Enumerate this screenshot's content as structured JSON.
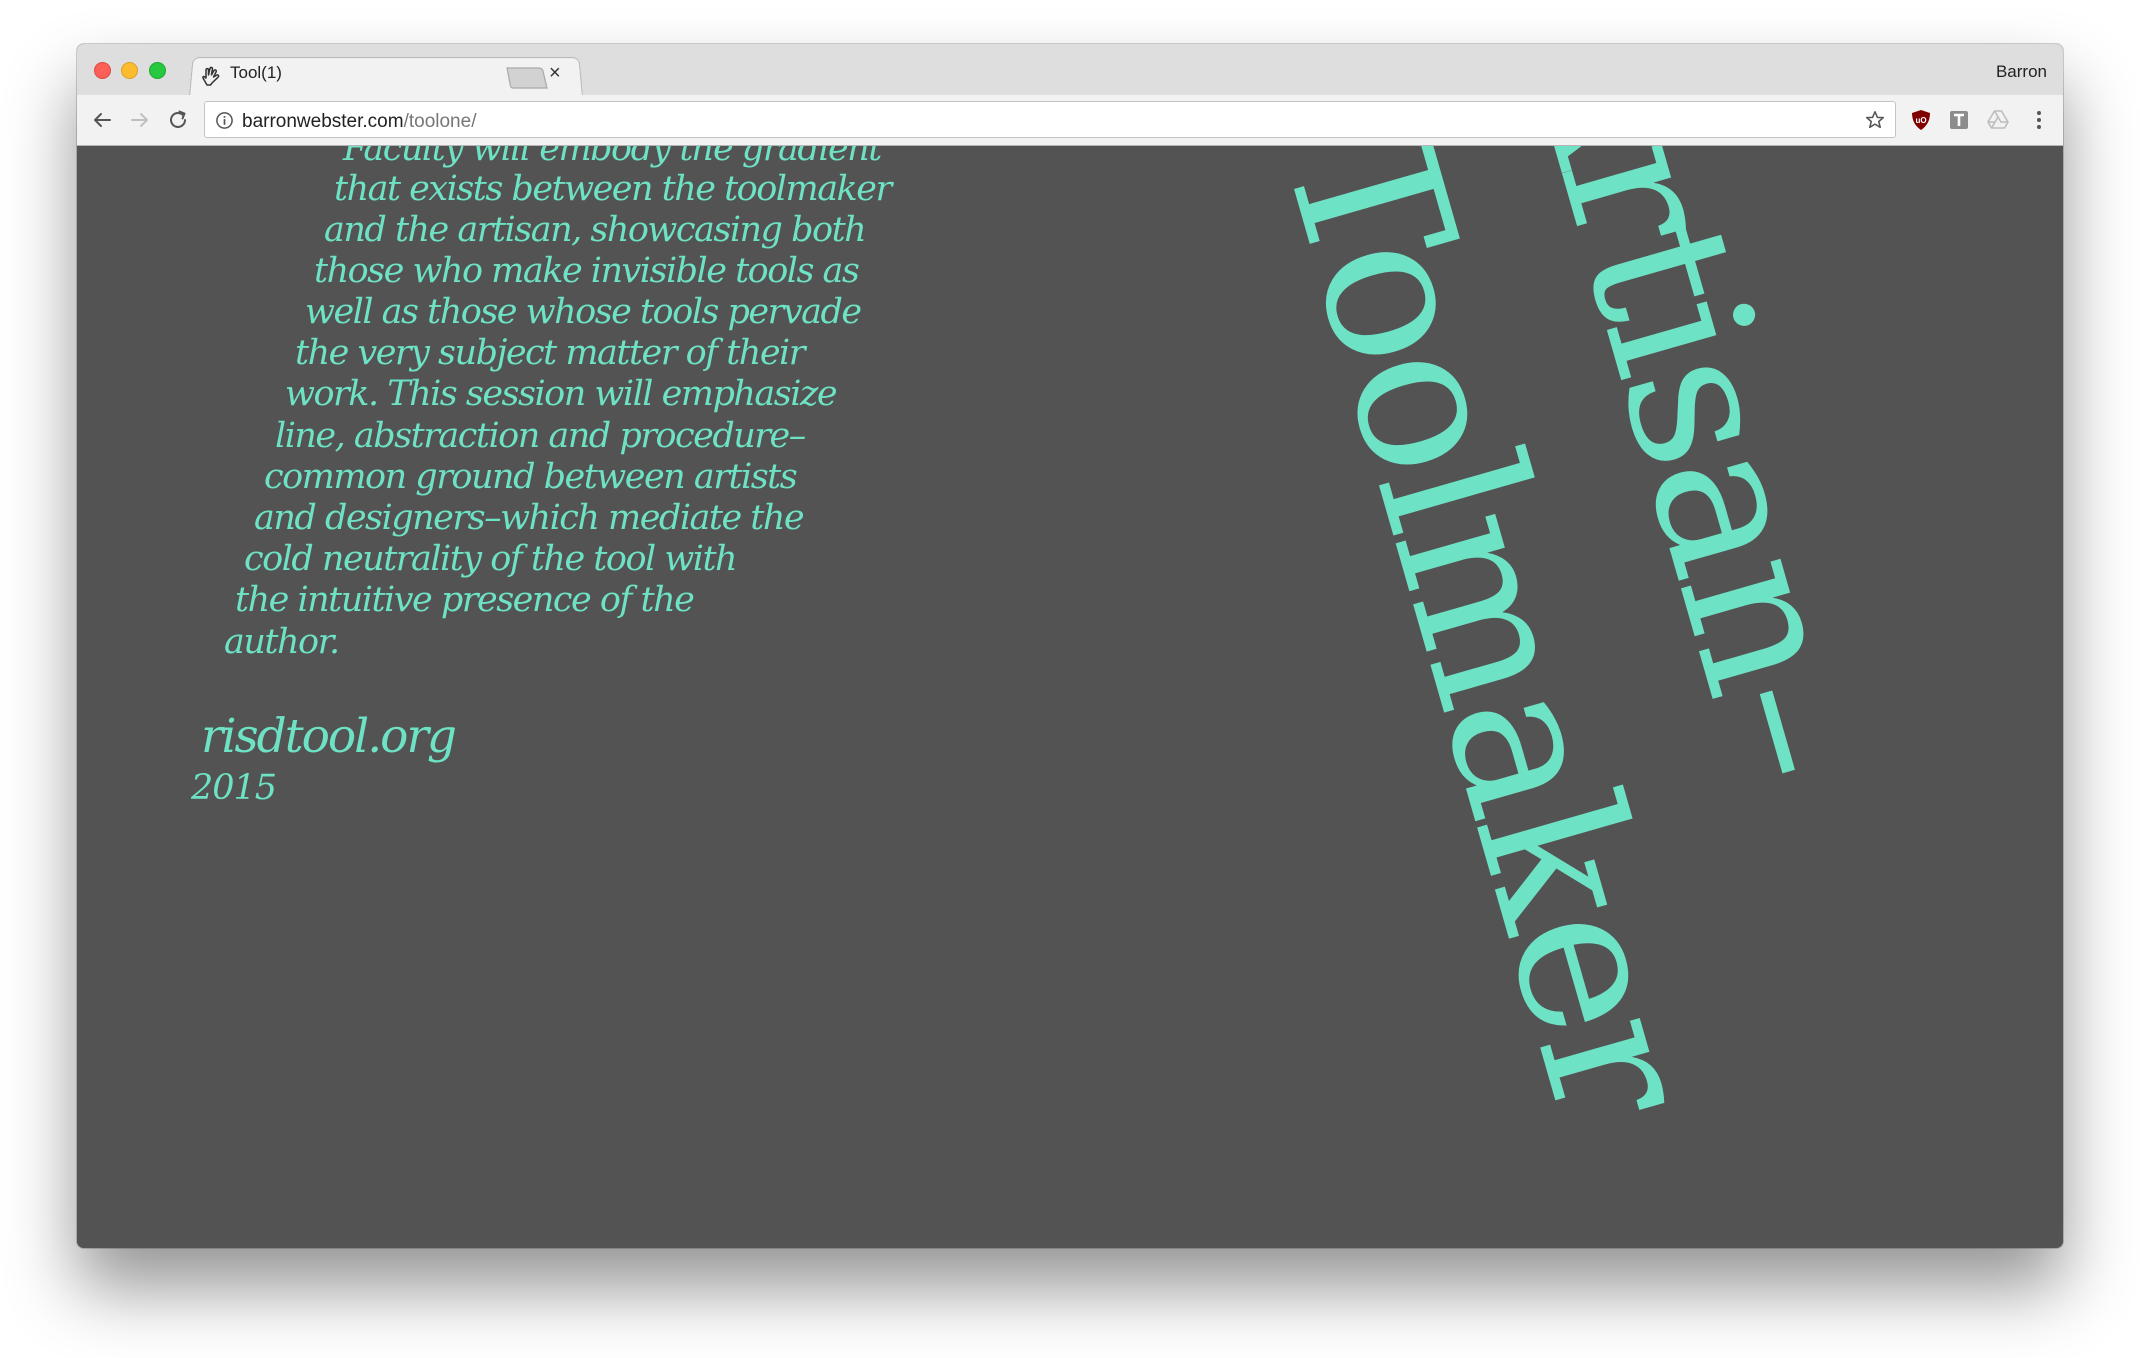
{
  "browser": {
    "tab_title": "Tool(1)",
    "tab_close": "×",
    "profile_name": "Barron",
    "url_host": "barronwebster.com",
    "url_path": "/toolone/"
  },
  "page": {
    "paragraph_lines": [
      "Faculty will embody the gradient",
      "that exists between the toolmaker",
      "and the artisan, showcasing both",
      "those who make invisible tools as",
      "well as those whose tools pervade",
      "the very subject matter of their",
      "work. This session will emphasize",
      "line, abstraction and procedure–",
      "common ground between artists",
      "and designers–which mediate the",
      "cold neutrality of the tool with",
      "the intuitive presence of the",
      "author."
    ],
    "site_link": "risdtool.org",
    "year": "2015",
    "big_words": [
      "Artisan–",
      "Toolmaker"
    ]
  },
  "colors": {
    "accent": "#6ee2c4",
    "page_background": "#535353",
    "tabstrip": "#dedede",
    "toolbar": "#f2f2f2"
  },
  "icons": {
    "favicon": "hand-pointer-icon",
    "back": "back-arrow-icon",
    "forward": "forward-arrow-icon",
    "reload": "reload-icon",
    "info": "info-icon",
    "bookmark": "star-icon",
    "extensions": [
      "ublock-shield-icon",
      "t-extension-icon",
      "drive-icon",
      "more-vert-icon"
    ]
  }
}
